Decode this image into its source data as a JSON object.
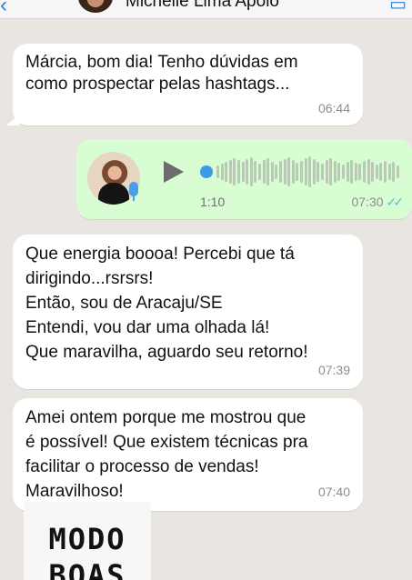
{
  "header": {
    "back": "‹",
    "contact_name": "Michelle Lima Apoio",
    "right_icon": "video-camera-icon"
  },
  "messages": [
    {
      "type": "text",
      "direction": "in",
      "text": "Márcia, bom dia! Tenho dúvidas em\ncomo prospectar pelas hashtags...",
      "time": "06:44"
    },
    {
      "type": "voice",
      "direction": "out",
      "duration": "1:10",
      "time": "07:30",
      "status": "✓✓",
      "status_color": "#53bdeb"
    },
    {
      "type": "text",
      "direction": "in",
      "text": "Que energia boooa! Percebi que tá\ndirigindo...rsrsrs!\nEntão, sou de Aracaju/SE\nEntendi, vou dar uma olhada lá!\nQue maravilha, aguardo seu retorno!",
      "time": "07:39"
    },
    {
      "type": "text",
      "direction": "in",
      "text": "Amei ontem porque me mostrou que\né possível! Que existem técnicas pra\nfacilitar o processo de vendas!\nMaravilhoso!",
      "time": "07:40"
    }
  ],
  "sticker": {
    "line1": "MODO",
    "line2": "BOAS"
  },
  "colors": {
    "incoming_bubble": "#ffffff",
    "outgoing_bubble": "#d9fdd3",
    "chat_background": "#e9e5e0",
    "accent": "#2f7fd8"
  }
}
